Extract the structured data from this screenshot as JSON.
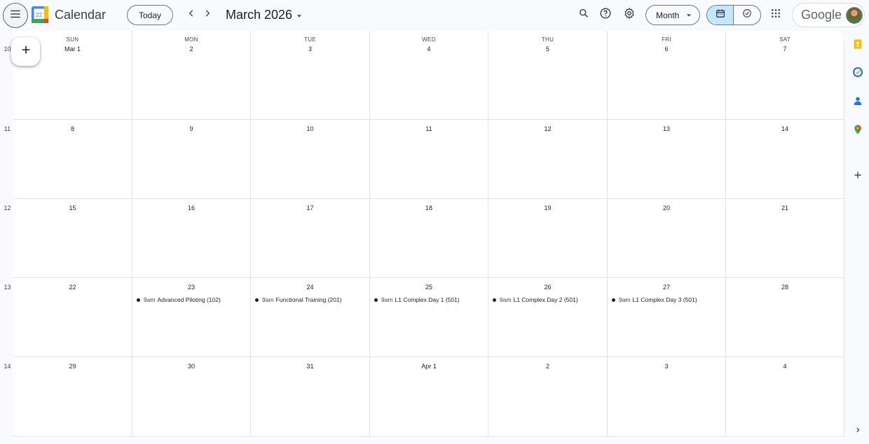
{
  "header": {
    "app_title": "Calendar",
    "logo_day": "22",
    "today_label": "Today",
    "month_title": "March 2026",
    "view_label": "Month",
    "brand": "Google"
  },
  "icons": {
    "menu": "menu-icon",
    "prev": "chevron-left-icon",
    "next": "chevron-right-icon",
    "search": "search-icon",
    "help": "help-icon",
    "settings": "gear-icon",
    "calendar_view": "calendar-icon",
    "tasks_view": "task-check-icon",
    "apps": "apps-grid-icon",
    "create": "plus-icon"
  },
  "colors": {
    "accent_selected": "#c2e7ff",
    "keep_yellow": "#fbbc04",
    "tasks_blue": "#1a73e8",
    "maps_green": "#34a853",
    "maps_red": "#ea4335"
  },
  "weekdays": [
    "SUN",
    "MON",
    "TUE",
    "WED",
    "THU",
    "FRI",
    "SAT"
  ],
  "weeks": [
    {
      "number": "10",
      "days": [
        {
          "label": "Mar 1",
          "events": []
        },
        {
          "label": "2",
          "events": []
        },
        {
          "label": "3",
          "events": []
        },
        {
          "label": "4",
          "events": []
        },
        {
          "label": "5",
          "events": []
        },
        {
          "label": "6",
          "events": []
        },
        {
          "label": "7",
          "events": []
        }
      ]
    },
    {
      "number": "11",
      "days": [
        {
          "label": "8",
          "events": []
        },
        {
          "label": "9",
          "events": []
        },
        {
          "label": "10",
          "events": []
        },
        {
          "label": "11",
          "events": []
        },
        {
          "label": "12",
          "events": []
        },
        {
          "label": "13",
          "events": []
        },
        {
          "label": "14",
          "events": []
        }
      ]
    },
    {
      "number": "12",
      "days": [
        {
          "label": "15",
          "events": []
        },
        {
          "label": "16",
          "events": []
        },
        {
          "label": "17",
          "events": []
        },
        {
          "label": "18",
          "events": []
        },
        {
          "label": "19",
          "events": []
        },
        {
          "label": "20",
          "events": []
        },
        {
          "label": "21",
          "events": []
        }
      ]
    },
    {
      "number": "13",
      "days": [
        {
          "label": "22",
          "events": []
        },
        {
          "label": "23",
          "events": [
            {
              "time": "9am",
              "title": "Advanced Piloting (102)"
            }
          ]
        },
        {
          "label": "24",
          "events": [
            {
              "time": "9am",
              "title": "Functional Training (201)"
            }
          ]
        },
        {
          "label": "25",
          "events": [
            {
              "time": "9am",
              "title": "L1 Complex Day 1 (501)"
            }
          ]
        },
        {
          "label": "26",
          "events": [
            {
              "time": "9am",
              "title": "L1 Complex Day 2 (501)"
            }
          ]
        },
        {
          "label": "27",
          "events": [
            {
              "time": "9am",
              "title": "L1 Complex Day 3 (501)"
            }
          ]
        },
        {
          "label": "28",
          "events": []
        }
      ]
    },
    {
      "number": "14",
      "days": [
        {
          "label": "29",
          "events": []
        },
        {
          "label": "30",
          "events": []
        },
        {
          "label": "31",
          "events": []
        },
        {
          "label": "Apr 1",
          "events": []
        },
        {
          "label": "2",
          "events": []
        },
        {
          "label": "3",
          "events": []
        },
        {
          "label": "4",
          "events": []
        }
      ]
    }
  ]
}
